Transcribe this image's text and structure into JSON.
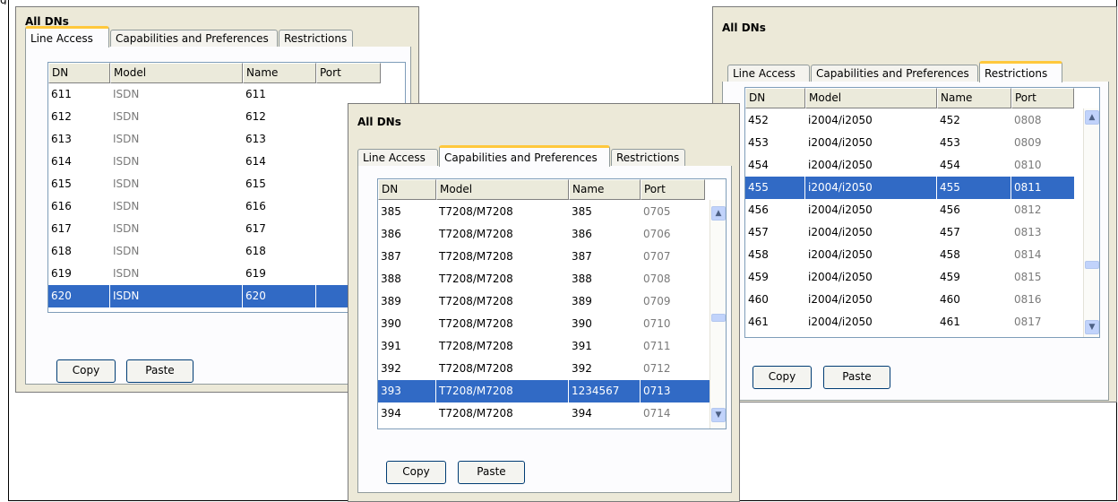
{
  "panels": {
    "left": {
      "title": "All DNs",
      "tabs": [
        "Line Access",
        "Capabilities and Preferences",
        "Restrictions"
      ],
      "active_tab": "Line Access",
      "columns": [
        "DN",
        "Model",
        "Name",
        "Port"
      ],
      "rows": [
        [
          "611",
          "ISDN",
          "611",
          ""
        ],
        [
          "612",
          "ISDN",
          "612",
          ""
        ],
        [
          "613",
          "ISDN",
          "613",
          ""
        ],
        [
          "614",
          "ISDN",
          "614",
          ""
        ],
        [
          "615",
          "ISDN",
          "615",
          ""
        ],
        [
          "616",
          "ISDN",
          "616",
          ""
        ],
        [
          "617",
          "ISDN",
          "617",
          ""
        ],
        [
          "618",
          "ISDN",
          "618",
          ""
        ],
        [
          "619",
          "ISDN",
          "619",
          ""
        ],
        [
          "620",
          "ISDN",
          "620",
          ""
        ]
      ],
      "selected_row": "620",
      "copy_label": "Copy",
      "paste_label": "Paste"
    },
    "middle": {
      "title": "All DNs",
      "tabs": [
        "Line Access",
        "Capabilities and Preferences",
        "Restrictions"
      ],
      "active_tab": "Capabilities and Preferences",
      "columns": [
        "DN",
        "Model",
        "Name",
        "Port"
      ],
      "rows": [
        [
          "385",
          "T7208/M7208",
          "385",
          "0705"
        ],
        [
          "386",
          "T7208/M7208",
          "386",
          "0706"
        ],
        [
          "387",
          "T7208/M7208",
          "387",
          "0707"
        ],
        [
          "388",
          "T7208/M7208",
          "388",
          "0708"
        ],
        [
          "389",
          "T7208/M7208",
          "389",
          "0709"
        ],
        [
          "390",
          "T7208/M7208",
          "390",
          "0710"
        ],
        [
          "391",
          "T7208/M7208",
          "391",
          "0711"
        ],
        [
          "392",
          "T7208/M7208",
          "392",
          "0712"
        ],
        [
          "393",
          "T7208/M7208",
          "1234567",
          "0713"
        ],
        [
          "394",
          "T7208/M7208",
          "394",
          "0714"
        ]
      ],
      "selected_row": "393",
      "copy_label": "Copy",
      "paste_label": "Paste"
    },
    "right": {
      "title": "All DNs",
      "tabs": [
        "Line Access",
        "Capabilities and Preferences",
        "Restrictions"
      ],
      "active_tab": "Restrictions",
      "columns": [
        "DN",
        "Model",
        "Name",
        "Port"
      ],
      "rows": [
        [
          "452",
          "i2004/i2050",
          "452",
          "0808"
        ],
        [
          "453",
          "i2004/i2050",
          "453",
          "0809"
        ],
        [
          "454",
          "i2004/i2050",
          "454",
          "0810"
        ],
        [
          "455",
          "i2004/i2050",
          "455",
          "0811"
        ],
        [
          "456",
          "i2004/i2050",
          "456",
          "0812"
        ],
        [
          "457",
          "i2004/i2050",
          "457",
          "0813"
        ],
        [
          "458",
          "i2004/i2050",
          "458",
          "0814"
        ],
        [
          "459",
          "i2004/i2050",
          "459",
          "0815"
        ],
        [
          "460",
          "i2004/i2050",
          "460",
          "0816"
        ],
        [
          "461",
          "i2004/i2050",
          "461",
          "0817"
        ]
      ],
      "selected_row": "455",
      "copy_label": "Copy",
      "paste_label": "Paste"
    }
  },
  "icons": {
    "scroll_up": "chevron-up-icon",
    "scroll_down": "chevron-down-icon"
  },
  "colors": {
    "selection": "#316ac5",
    "active_tab_accent": "#ffc83c",
    "dialog_bg": "#ece9d8"
  }
}
